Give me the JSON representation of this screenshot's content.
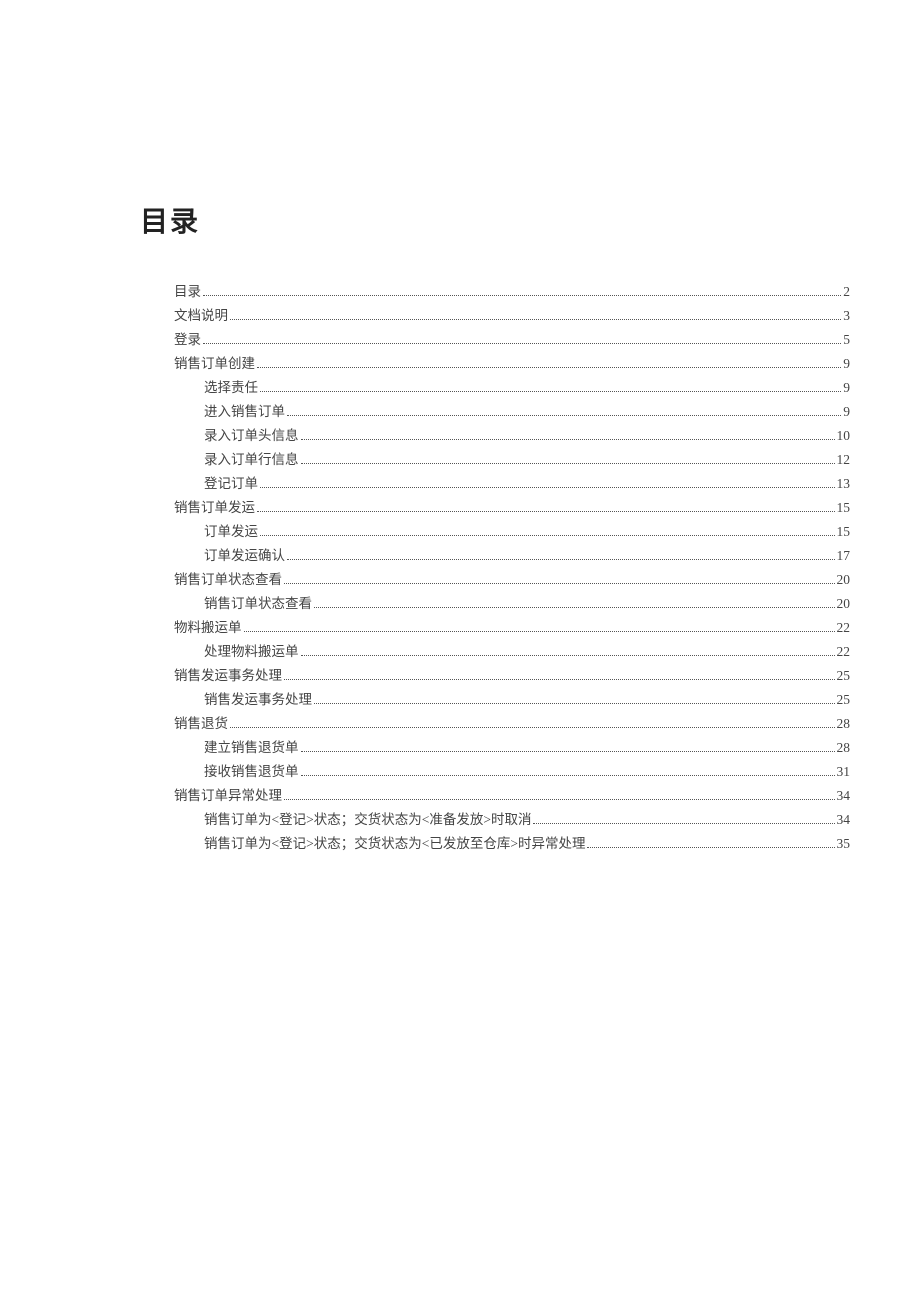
{
  "title": "目录",
  "toc": [
    {
      "level": 1,
      "label": "目录",
      "page": "2"
    },
    {
      "level": 1,
      "label": "文档说明",
      "page": "3"
    },
    {
      "level": 1,
      "label": "登录",
      "page": "5"
    },
    {
      "level": 1,
      "label": "销售订单创建",
      "page": "9"
    },
    {
      "level": 2,
      "label": "选择责任",
      "page": "9"
    },
    {
      "level": 2,
      "label": "进入销售订单",
      "page": "9"
    },
    {
      "level": 2,
      "label": "录入订单头信息",
      "page": "10"
    },
    {
      "level": 2,
      "label": "录入订单行信息",
      "page": "12"
    },
    {
      "level": 2,
      "label": "登记订单",
      "page": "13"
    },
    {
      "level": 1,
      "label": "销售订单发运",
      "page": "15"
    },
    {
      "level": 2,
      "label": "订单发运",
      "page": "15"
    },
    {
      "level": 2,
      "label": "订单发运确认",
      "page": "17"
    },
    {
      "level": 1,
      "label": "销售订单状态查看",
      "page": "20"
    },
    {
      "level": 2,
      "label": "销售订单状态查看",
      "page": "20"
    },
    {
      "level": 1,
      "label": "物料搬运单",
      "page": "22"
    },
    {
      "level": 2,
      "label": "处理物料搬运单",
      "page": "22"
    },
    {
      "level": 1,
      "label": "销售发运事务处理",
      "page": "25"
    },
    {
      "level": 2,
      "label": "销售发运事务处理",
      "page": "25"
    },
    {
      "level": 1,
      "label": "销售退货",
      "page": "28"
    },
    {
      "level": 2,
      "label": "建立销售退货单",
      "page": "28"
    },
    {
      "level": 2,
      "label": "接收销售退货单",
      "page": "31"
    },
    {
      "level": 1,
      "label": "销售订单异常处理",
      "page": "34"
    },
    {
      "level": 2,
      "label": "销售订单为<登记>状态；交货状态为<准备发放>时取消",
      "page": "34"
    },
    {
      "level": 2,
      "label": "销售订单为<登记>状态；交货状态为<已发放至仓库>时异常处理",
      "page": "35"
    }
  ]
}
